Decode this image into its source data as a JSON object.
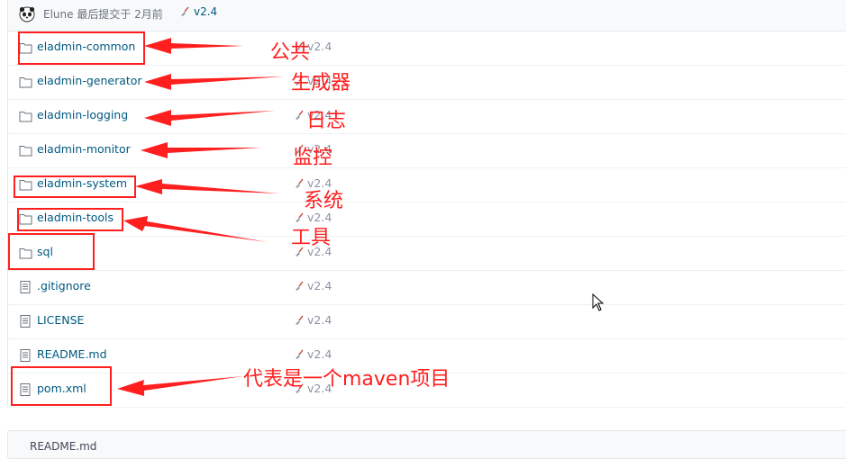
{
  "commit": {
    "author": "Elune",
    "info": "最后提交于 2月前",
    "tag": "v2.4"
  },
  "files": [
    {
      "name": "eladmin-common",
      "type": "folder",
      "message": "v2.4"
    },
    {
      "name": "eladmin-generator",
      "type": "folder",
      "message": "v2.4"
    },
    {
      "name": "eladmin-logging",
      "type": "folder",
      "message": "v2.4"
    },
    {
      "name": "eladmin-monitor",
      "type": "folder",
      "message": "v2.4"
    },
    {
      "name": "eladmin-system",
      "type": "folder",
      "message": "v2.4"
    },
    {
      "name": "eladmin-tools",
      "type": "folder",
      "message": "v2.4"
    },
    {
      "name": "sql",
      "type": "folder",
      "message": "v2.4"
    },
    {
      "name": ".gitignore",
      "type": "file",
      "message": "v2.4"
    },
    {
      "name": "LICENSE",
      "type": "file",
      "message": "v2.4"
    },
    {
      "name": "README.md",
      "type": "file",
      "message": "v2.4"
    },
    {
      "name": "pom.xml",
      "type": "file",
      "message": "v2.4"
    }
  ],
  "readme": {
    "label": "README.md"
  },
  "annotations": {
    "common": "公共",
    "generator": "生成器",
    "logging": "日志",
    "monitor": "监控",
    "system": "系统",
    "tools": "工具",
    "pom": "代表是一个maven项目"
  },
  "colors": {
    "annotation": "#ff1f1f",
    "link": "#005980",
    "muted": "#8c92a4"
  }
}
